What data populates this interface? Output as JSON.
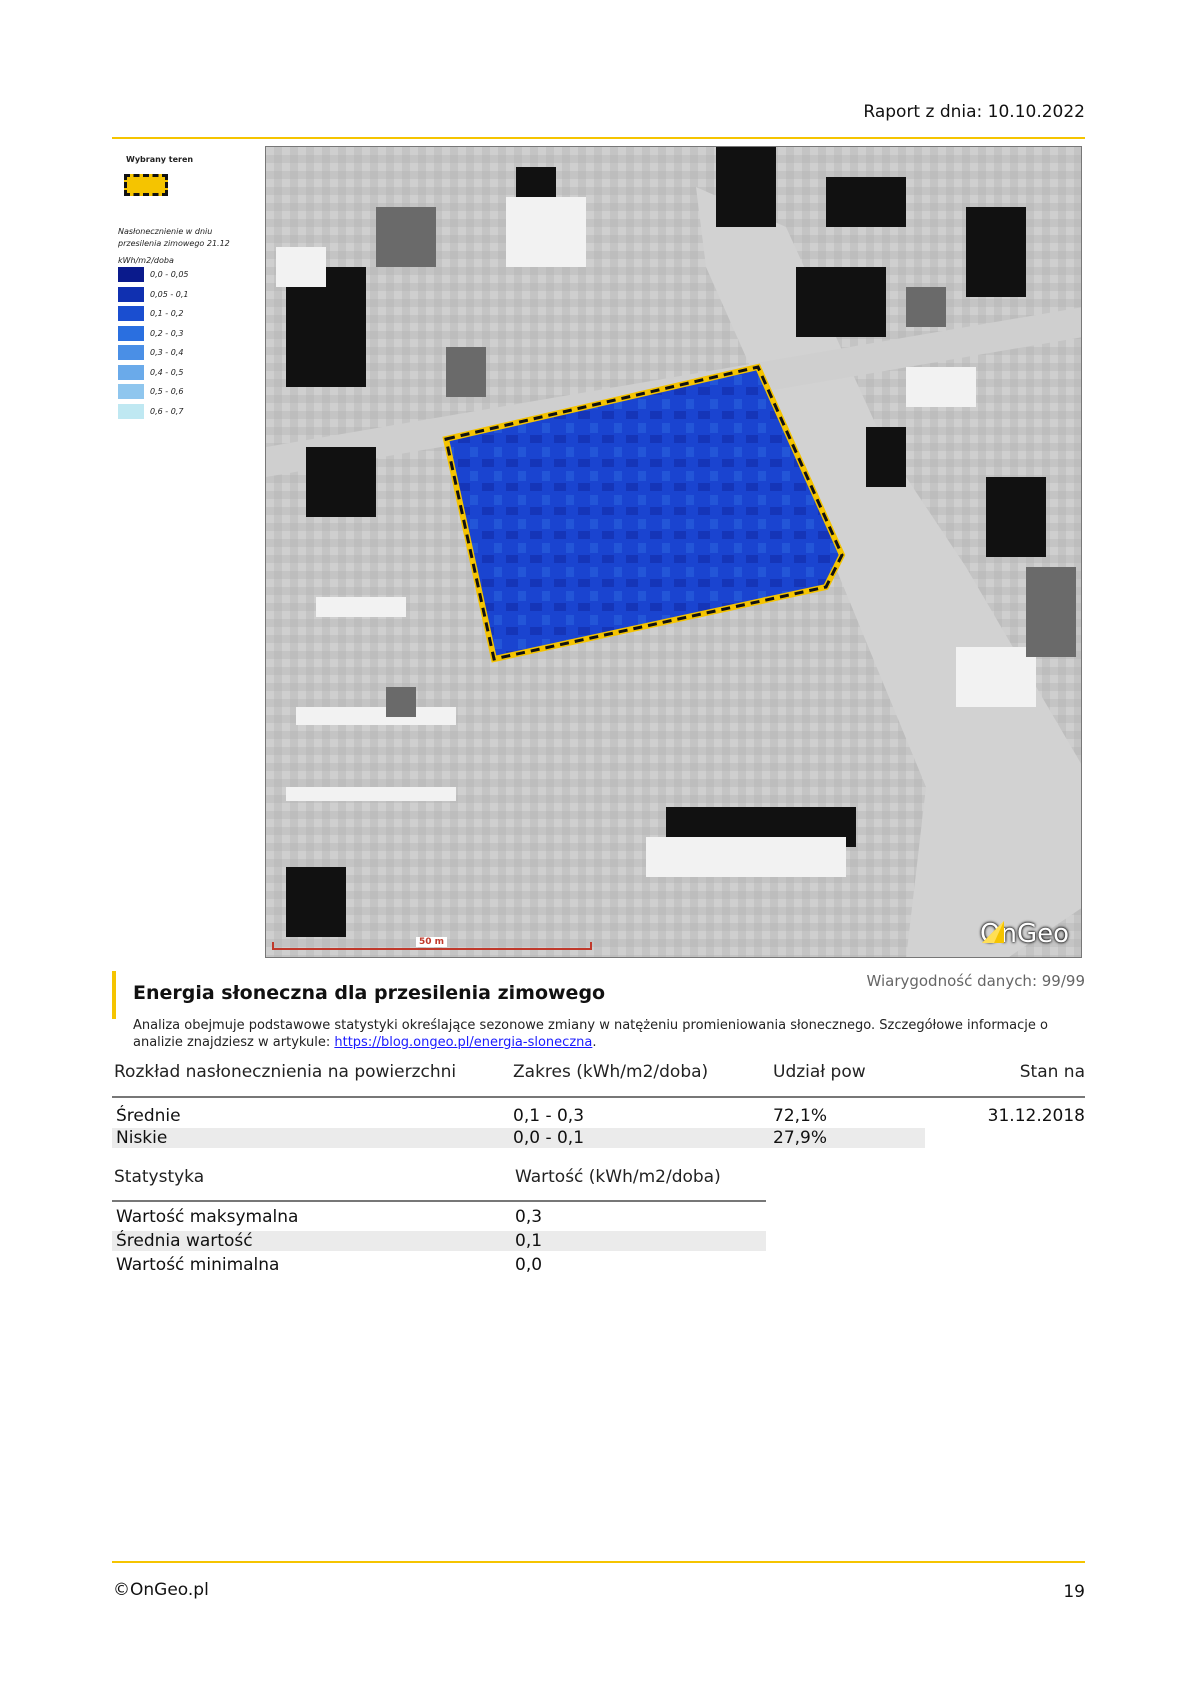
{
  "header": {
    "report_date": "Raport z dnia: 10.10.2022"
  },
  "legend": {
    "selected_area_title": "Wybrany teren",
    "title": "Nasłonecznienie w dniu przesilenia zimowego 21.12",
    "unit": "kWh/m2/doba",
    "items": [
      {
        "label": "0,0 - 0,05",
        "color": "#0a1a8c"
      },
      {
        "label": "0,05 - 0,1",
        "color": "#1030b0"
      },
      {
        "label": "0,1 - 0,2",
        "color": "#1a4ed0"
      },
      {
        "label": "0,2 - 0,3",
        "color": "#2a6fe0"
      },
      {
        "label": "0,3 - 0,4",
        "color": "#4a8fe6"
      },
      {
        "label": "0,4 - 0,5",
        "color": "#6aaaea"
      },
      {
        "label": "0,5 - 0,6",
        "color": "#8fc6ee"
      },
      {
        "label": "0,6 - 0,7",
        "color": "#bfe8f2"
      }
    ]
  },
  "map": {
    "scale_label": "50 m",
    "logo_text": "OnGeo"
  },
  "section": {
    "title": "Energia słoneczna dla przesilenia zimowego",
    "reliability": "Wiarygodność danych: 99/99",
    "description": "Analiza obejmuje podstawowe statystyki określające sezonowe zmiany w natężeniu promieniowania słonecznego. Szczegółowe informacje o analizie znajdziesz w artykule: ",
    "link_text": "https://blog.ongeo.pl/energia-sloneczna",
    "description_end": "."
  },
  "distribution_table": {
    "headers": [
      "Rozkład nasłonecznienia na powierzchni",
      "Zakres (kWh/m2/doba)",
      "Udział pow",
      "Stan na"
    ],
    "rows": [
      [
        "Średnie",
        "0,1 - 0,3",
        "72,1%"
      ],
      [
        "Niskie",
        "0,0 - 0,1",
        "27,9%"
      ]
    ],
    "date": "31.12.2018"
  },
  "stats_table": {
    "headers": [
      "Statystyka",
      "Wartość (kWh/m2/doba)"
    ],
    "rows": [
      [
        "Wartość maksymalna",
        "0,3"
      ],
      [
        "Średnia wartość",
        "0,1"
      ],
      [
        "Wartość minimalna",
        "0,0"
      ]
    ]
  },
  "footer": {
    "brand": "©OnGeo.pl",
    "page": "19"
  },
  "colors": {
    "accent": "#f5c400",
    "parcel": "#1a4ed0",
    "link": "#1a1aff"
  }
}
